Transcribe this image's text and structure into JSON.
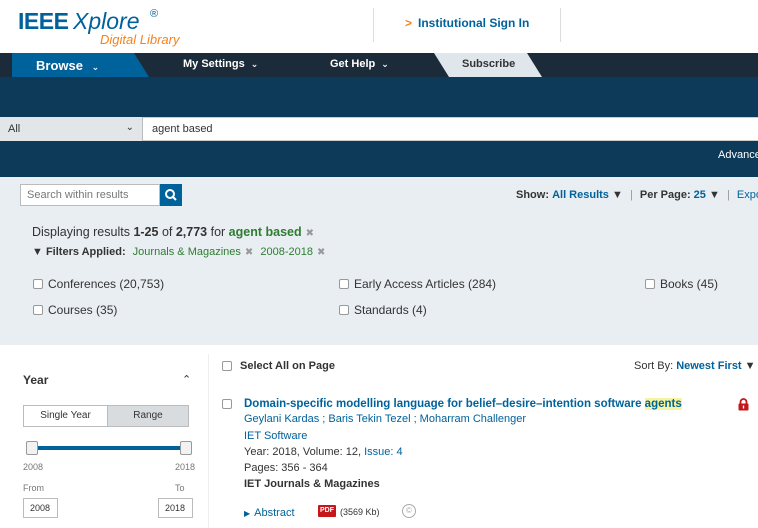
{
  "header": {
    "logo_ieee": "IEEE",
    "logo_xplore": "Xplore",
    "logo_reg": "®",
    "logo_sub": "Digital Library",
    "institutional_sign_in": "Institutional Sign In"
  },
  "nav": {
    "browse": "Browse",
    "my_settings": "My Settings",
    "get_help": "Get Help",
    "subscribe": "Subscribe"
  },
  "search": {
    "scope": "All",
    "query": "agent based",
    "advanced": "Advanced"
  },
  "results_bar": {
    "search_within_placeholder": "Search within results",
    "show_label": "Show:",
    "show_value": "All Results",
    "per_page_label": "Per Page:",
    "per_page_value": "25",
    "export": "Export"
  },
  "summary": {
    "prefix": "Displaying results ",
    "range": "1-25",
    "of": " of ",
    "total": "2,773",
    "for": " for ",
    "query": "agent based",
    "filters_label": "Filters Applied:",
    "filters": [
      "Journals & Magazines",
      "2008-2018"
    ]
  },
  "facets": [
    {
      "label": "Conferences (20,753)"
    },
    {
      "label": "Early Access Articles (284)"
    },
    {
      "label": "Books (45)"
    },
    {
      "label": "Courses (35)"
    },
    {
      "label": "Standards (4)"
    }
  ],
  "sidebar": {
    "year_title": "Year",
    "single_year": "Single Year",
    "range": "Range",
    "min_year": "2008",
    "max_year": "2018",
    "from_label": "From",
    "to_label": "To",
    "from_value": "2008",
    "to_value": "2018"
  },
  "results_header": {
    "select_all": "Select All on Page",
    "sort_label": "Sort By:",
    "sort_value": "Newest First"
  },
  "result": {
    "title_main": "Domain-specific modelling language for belief–desire–intention software ",
    "title_highlight": "agents",
    "authors": "Geylani Kardas ; Baris Tekin Tezel ; Moharram Challenger",
    "journal": "IET Software",
    "year_text": "Year: 2018, Volume: 12, ",
    "issue": "Issue: 4",
    "pages": "Pages: 356 - 364",
    "publisher": "IET Journals & Magazines",
    "abstract": "Abstract",
    "pdf_badge": "PDF",
    "pdf_size": "(3569 Kb)",
    "copyright_symbol": "©"
  },
  "colors": {
    "ieee_blue": "#00629b",
    "nav_dark": "#1c2b39",
    "band_dark": "#0e3a5a",
    "accent_orange": "#f5821f",
    "filter_green": "#2e7d32",
    "lock_red": "#c4161c"
  }
}
